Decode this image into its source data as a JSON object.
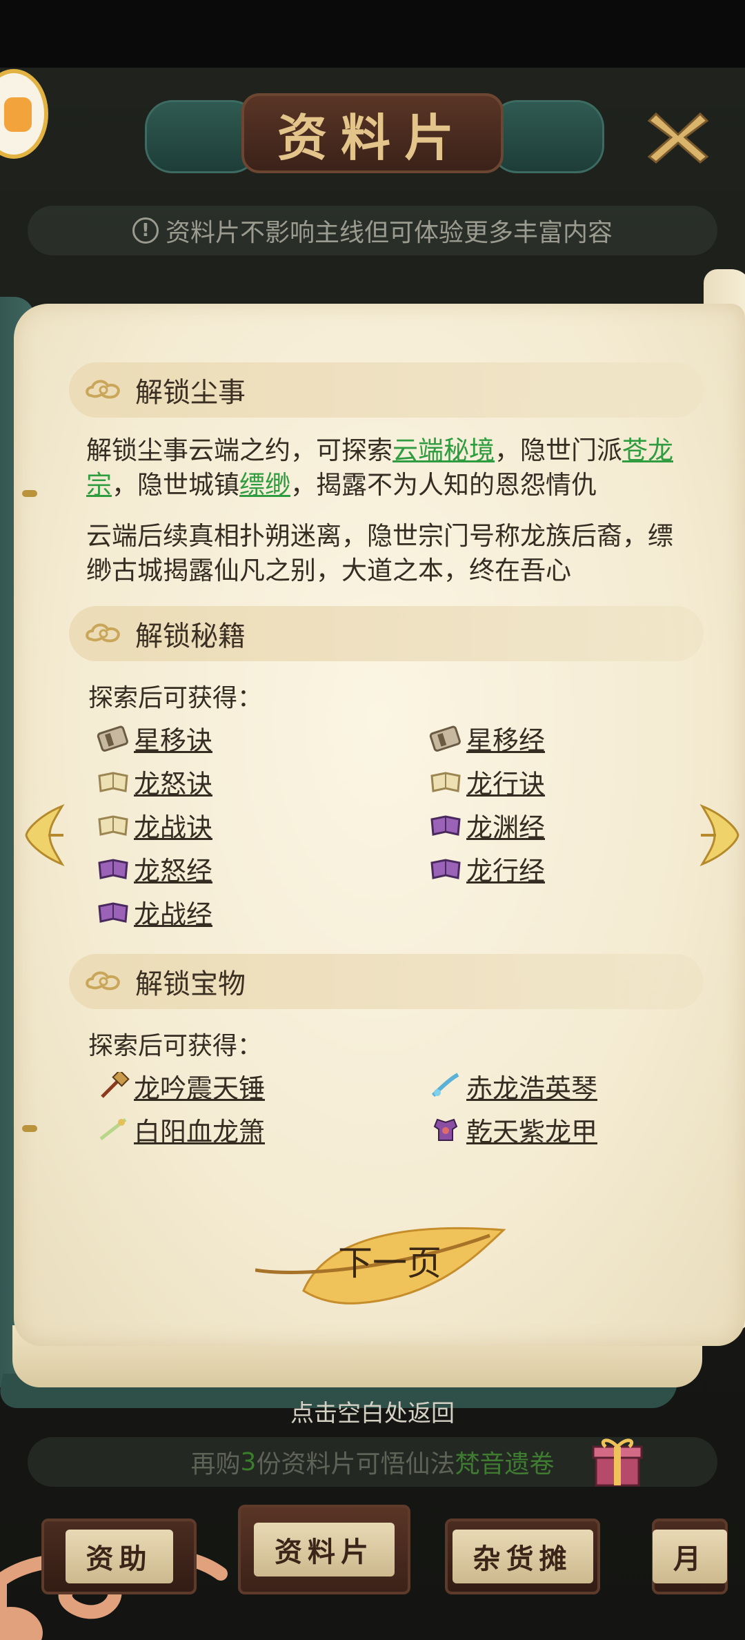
{
  "header": {
    "title": "资料片",
    "notice": "资料片不影响主线但可体验更多丰富内容",
    "notice_icon": "exclamation-icon",
    "close_icon": "close-icon"
  },
  "sections": {
    "dust": {
      "title": "解锁尘事",
      "para1": {
        "t1": "解锁尘事云端之约，可探索",
        "l1": "云端秘境",
        "t2": "，隐世门派",
        "l2": "苍龙宗",
        "t3": "，隐世城镇",
        "l3": "缥缈",
        "t4": "，揭露不为人知的恩怨情仇"
      },
      "para2": "云端后续真相扑朔迷离，隐世宗门号称龙族后裔，缥缈古城揭露仙凡之别，大道之本，终在吾心"
    },
    "secrets": {
      "title": "解锁秘籍",
      "explore": "探索后可获得：",
      "items": [
        {
          "label": "星移诀",
          "icon": "scroll-book-icon"
        },
        {
          "label": "星移经",
          "icon": "scroll-book-icon"
        },
        {
          "label": "龙怒诀",
          "icon": "yellow-book-icon"
        },
        {
          "label": "龙行诀",
          "icon": "yellow-book-icon"
        },
        {
          "label": "龙战诀",
          "icon": "yellow-book-icon"
        },
        {
          "label": "龙渊经",
          "icon": "purple-book-icon"
        },
        {
          "label": "龙怒经",
          "icon": "purple-book-icon"
        },
        {
          "label": "龙行经",
          "icon": "purple-book-icon"
        },
        {
          "label": "龙战经",
          "icon": "purple-book-icon"
        }
      ]
    },
    "treasures": {
      "title": "解锁宝物",
      "explore": "探索后可获得：",
      "items": [
        {
          "label": "龙吟震天锤",
          "icon": "hammer-icon"
        },
        {
          "label": "赤龙浩英琴",
          "icon": "zither-icon"
        },
        {
          "label": "白阳血龙箫",
          "icon": "flute-icon"
        },
        {
          "label": "乾天紫龙甲",
          "icon": "armor-icon"
        }
      ]
    }
  },
  "next_button": "下一页",
  "back_tip": "点击空白处返回",
  "buy_bar": {
    "prefix": "再购",
    "count": "3",
    "mid": "份资料片可悟仙法",
    "name": "梵音遗卷"
  },
  "tabs": [
    "资助",
    "资料片",
    "杂货摊",
    "月"
  ],
  "colors": {
    "link_green": "#2e9c3f",
    "page_bg": "#f4ebd2",
    "tab_brown": "#3b2219"
  }
}
